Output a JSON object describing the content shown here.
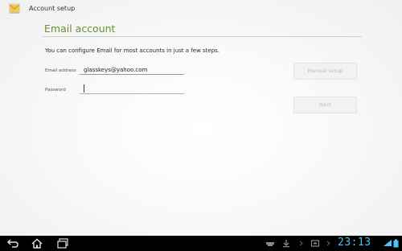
{
  "window": {
    "title": "Account setup",
    "icon": "email-envelope-icon"
  },
  "form": {
    "heading": "Email account",
    "instructions": "You can configure Email for most accounts in just a few steps.",
    "email_label": "Email address",
    "email_value": "glasskeys@yahoo.com",
    "password_label": "Password",
    "password_value": ""
  },
  "buttons": {
    "manual_setup": "Manual setup",
    "next": "Next"
  },
  "navbar": {
    "icons": [
      "back-icon",
      "home-icon",
      "recent-apps-icon"
    ]
  },
  "status_bar": {
    "time": "23:13",
    "icons": [
      "usb-icon",
      "download-icon",
      "screenshot-icon",
      "wifi-icon",
      "battery-icon"
    ]
  },
  "colors": {
    "heading": "#6b8f2e",
    "time": "#4fc3f7",
    "navbar": "#000000"
  }
}
